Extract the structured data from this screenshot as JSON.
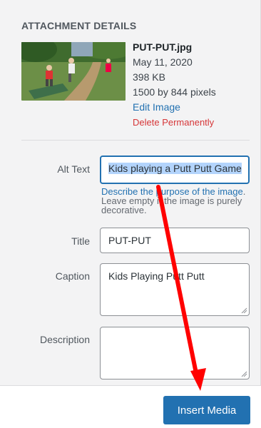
{
  "panel": {
    "title": "ATTACHMENT DETAILS",
    "file": {
      "name": "PUT-PUT.jpg",
      "date": "May 11, 2020",
      "size": "398 KB",
      "dimensions": "1500 by 844 pixels",
      "edit_label": "Edit Image",
      "delete_label": "Delete Permanently"
    }
  },
  "form": {
    "alt_text": {
      "label": "Alt Text",
      "value": "Kids playing a Putt Putt Game",
      "help_link": "Describe the purpose of the image",
      "help_rest": ". Leave empty if the image is purely decorative."
    },
    "title": {
      "label": "Title",
      "value": "PUT-PUT"
    },
    "caption": {
      "label": "Caption",
      "value": "Kids Playing Putt Putt"
    },
    "description": {
      "label": "Description",
      "value": ""
    }
  },
  "footer": {
    "insert_label": "Insert Media"
  },
  "colors": {
    "accent": "#2271b1",
    "danger": "#d63638",
    "annotation_arrow": "#ff0000"
  }
}
